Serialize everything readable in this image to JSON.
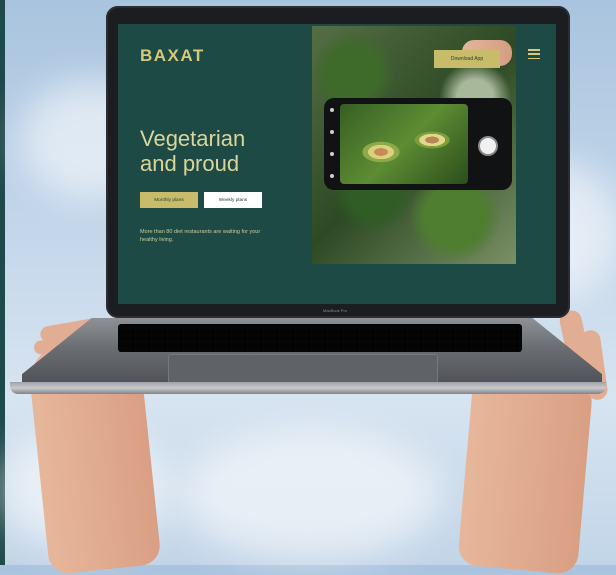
{
  "site": {
    "logo": "BAXAT",
    "headline_line1": "Vegetarian",
    "headline_line2": "and proud",
    "monthly_label": "Monthly plans",
    "weekly_label": "Weekly plans",
    "tagline": "More than 80 diet restaurants are waiting for your healthy living.",
    "download_label": "Download App",
    "menu_icon": "hamburger-menu-icon",
    "colors": {
      "background": "#1d4a44",
      "accent": "#c8bc6a",
      "headline": "#d9d59b"
    }
  },
  "laptop": {
    "model_label": "MacBook Pro"
  }
}
